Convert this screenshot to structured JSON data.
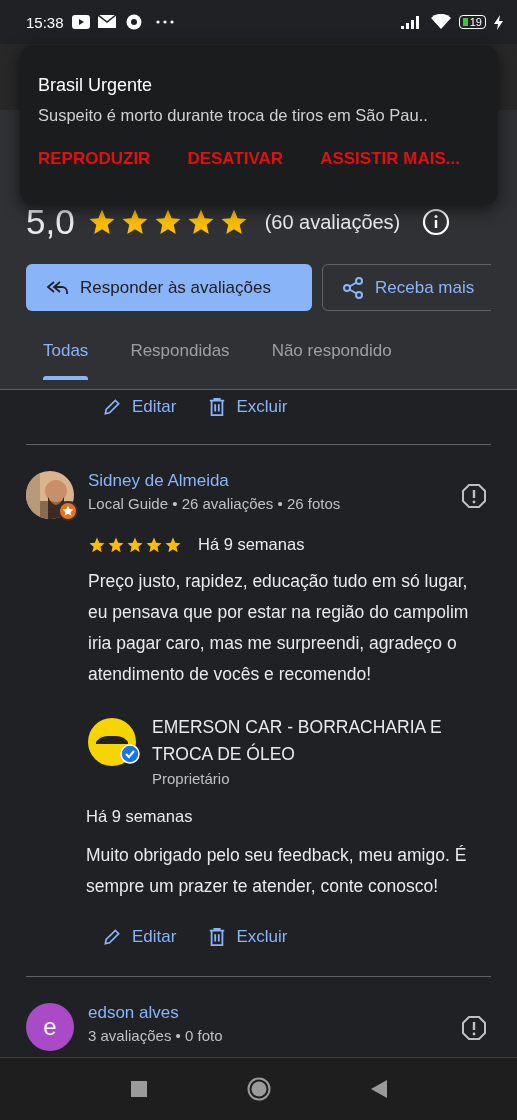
{
  "status_bar": {
    "time": "15:38",
    "battery": "19",
    "charging": true
  },
  "notification": {
    "app": "Brasil Urgente",
    "text": "Suspeito é morto durante troca de tiros em São Pau..",
    "actions": [
      "REPRODUZIR",
      "DESATIVAR",
      "ASSISTIR MAIS..."
    ]
  },
  "summary": {
    "rating": "5,0",
    "stars": 5,
    "count": "(60 avaliações)"
  },
  "buttons": [
    {
      "label": "Responder às avaliações",
      "kind": "primary"
    },
    {
      "label": "Receba mais",
      "kind": "share"
    }
  ],
  "tabs": [
    {
      "label": "Todas",
      "selected": true
    },
    {
      "label": "Respondidas",
      "selected": false
    },
    {
      "label": "Não respondido",
      "selected": false
    }
  ],
  "top_actions": [
    "Editar",
    "Excluir"
  ],
  "reviews": [
    {
      "name": "Sidney de Almeida",
      "meta": "Local Guide • 26 avaliações • 26 fotos",
      "avatar": {
        "kind": "picture"
      },
      "local_guide": true,
      "stars": 5,
      "time": "Há 9 semanas",
      "text": "Preço justo, rapidez, educação tudo em só lugar, eu pensava que por estar na região do campolim iria pagar caro, mas me surpreendi, agradeço o atendimento de vocês e recomendo!",
      "reply": {
        "business": "EMERSON CAR - BORRACHARIA E TROCA DE ÓLEO",
        "role": "Proprietário",
        "verified": true,
        "time": "Há 9 semanas",
        "text": "Muito obrigado pelo seu feedback, meu amigo. É sempre um prazer te atender, conte conosco!"
      },
      "actions": [
        "Editar",
        "Excluir"
      ]
    },
    {
      "name": "edson alves",
      "meta": "3 avaliações • 0 foto",
      "avatar": {
        "kind": "initial",
        "initial": "e",
        "color": "#a94bc6"
      }
    }
  ]
}
